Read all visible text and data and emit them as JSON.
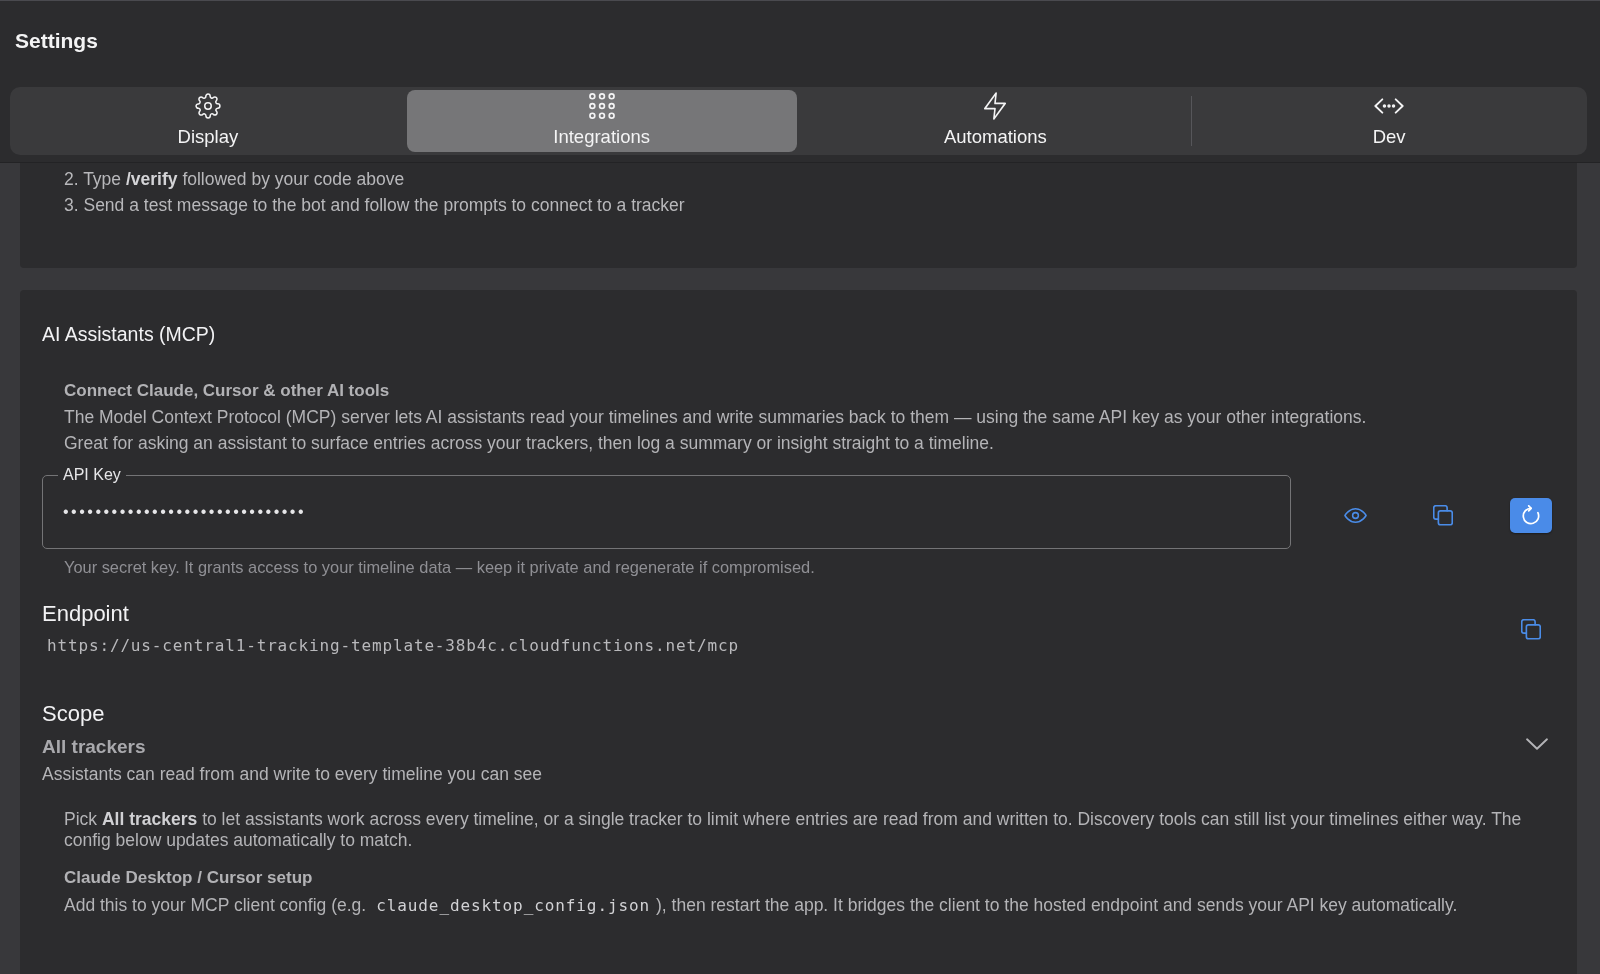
{
  "window": {
    "title": "Settings"
  },
  "tabs": [
    {
      "label": "Display",
      "selected": false
    },
    {
      "label": "Integrations",
      "selected": true
    },
    {
      "label": "Automations",
      "selected": false
    },
    {
      "label": "Dev",
      "selected": false
    }
  ],
  "setup_steps": [
    "2. Type **/verify** followed by your code above",
    "3. Send a test message to the bot and follow the prompts to connect to a tracker"
  ],
  "mcp": {
    "title": "AI Assistants (MCP)",
    "intro_title": "Connect Claude, Cursor & other AI tools",
    "intro_lines": [
      "The Model Context Protocol (MCP) server lets AI assistants read your timelines and write summaries back to them — using the same API key as your other integrations.",
      "Great for asking an assistant to surface entries across your trackers, then log a summary or insight straight to a timeline."
    ],
    "api_key": {
      "label": "API Key",
      "value": "••••••••••••••••••••••••••••••",
      "helper": "Your secret key. It grants access to your timeline data — keep it private and regenerate if compromised."
    },
    "endpoint": {
      "title": "Endpoint",
      "url": "https://us-central1-tracking-template-38b4c.cloudfunctions.net/mcp"
    },
    "scope": {
      "title": "Scope",
      "value": "All trackers",
      "description": "Assistants can read from and write to every timeline you can see"
    },
    "scope_note": "Pick **All trackers** to let assistants work across every timeline, or a single tracker to limit where entries are read from and written to. Discovery tools can still list your timelines either way. The config below updates automatically to match.",
    "client_setup": {
      "title": "Claude Desktop / Cursor setup",
      "text_before": "Add this to your MCP client config (e.g.",
      "code": "claude_desktop_config.json",
      "text_after": "), then restart the app. It bridges the client to the hosted endpoint and sends your API key automatically."
    }
  }
}
